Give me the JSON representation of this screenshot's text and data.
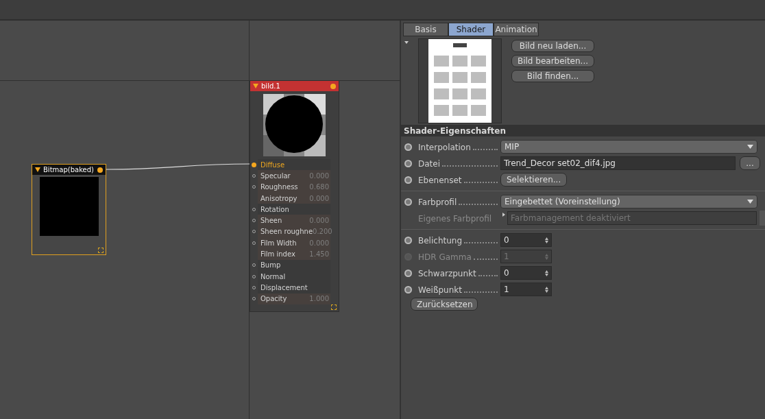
{
  "node_editor": {
    "nodes": [
      {
        "kind": "material",
        "title": "bild.1",
        "ports": [
          {
            "label": "Diffuse",
            "port": true,
            "connected": true
          },
          {
            "label": "Specular",
            "value": "0.000",
            "port": true,
            "connected": false
          },
          {
            "label": "Roughness",
            "value": "0.680",
            "port": true,
            "connected": false
          },
          {
            "label": "Anisotropy",
            "value": "0.000",
            "port": false,
            "connected": false
          },
          {
            "label": "Rotation",
            "port": true,
            "connected": false
          },
          {
            "label": "Sheen",
            "value": "0.000",
            "port": true,
            "connected": false
          },
          {
            "label": "Sheen roughne",
            "value": "0.200",
            "port": true,
            "connected": false
          },
          {
            "label": "Film Width",
            "value": "0.000",
            "port": true,
            "connected": false
          },
          {
            "label": "Film index",
            "value": "1.450",
            "port": false,
            "connected": false
          },
          {
            "label": "Bump",
            "port": true,
            "connected": false
          },
          {
            "label": "Normal",
            "port": true,
            "connected": false
          },
          {
            "label": "Displacement",
            "port": true,
            "connected": false
          },
          {
            "label": "Opacity",
            "value": "1.000",
            "port": true,
            "connected": false
          }
        ]
      },
      {
        "kind": "bitmap",
        "title": "Bitmap(baked)",
        "selected": true
      }
    ]
  },
  "attributes": {
    "tabs": [
      {
        "label": "Basis",
        "selected": false
      },
      {
        "label": "Shader",
        "selected": true
      },
      {
        "label": "Animation",
        "selected": false
      }
    ],
    "preview_buttons": [
      "Bild neu laden...",
      "Bild bearbeiten...",
      "Bild finden..."
    ],
    "section_title": "Shader-Eigenschaften",
    "groups": [
      [
        {
          "kind": "dropdown",
          "label": "Interpolation",
          "value": "MIP",
          "enabled": true
        },
        {
          "kind": "file",
          "label": "Datei",
          "value": "Trend_Decor set02_dif4.jpg",
          "button": "...",
          "enabled": true
        },
        {
          "kind": "button",
          "label": "Ebenenset",
          "value": "Selektieren...",
          "enabled": true
        }
      ],
      [
        {
          "kind": "dropdown",
          "label": "Farbprofil",
          "value": "Eingebettet (Voreinstellung)",
          "enabled": true
        },
        {
          "kind": "text",
          "label": "Eigenes Farbprofil",
          "value": "Farbmanagement deaktiviert",
          "enabled": false
        }
      ],
      [
        {
          "kind": "number",
          "label": "Belichtung",
          "value": "0",
          "enabled": true
        },
        {
          "kind": "number",
          "label": "HDR Gamma",
          "value": "1",
          "enabled": false
        },
        {
          "kind": "number",
          "label": "Schwarzpunkt",
          "value": "0",
          "enabled": true
        },
        {
          "kind": "number",
          "label": "Weißpunkt",
          "value": "1",
          "enabled": true
        }
      ]
    ],
    "reset_button": "Zurücksetzen"
  }
}
